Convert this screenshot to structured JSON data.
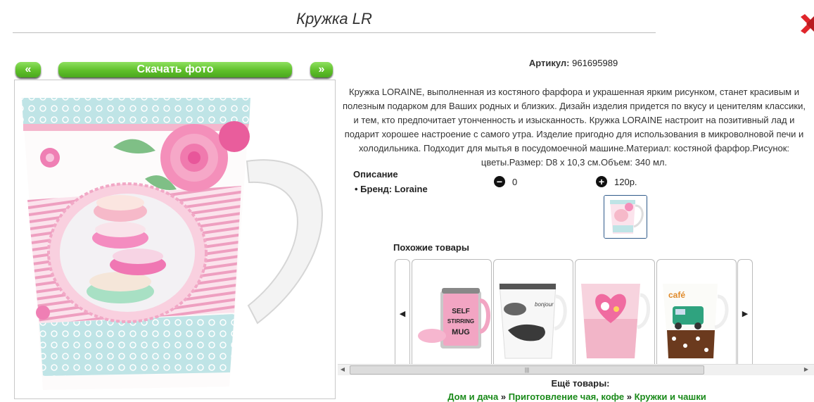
{
  "product": {
    "title": "Кружка LR",
    "sku_label": "Артикул:",
    "sku_value": "961695989",
    "description": "Кружка LORAINE, выполненная из костяного фарфора и украшенная ярким рисунком, станет красивым и полезным подарком для Ваших родных и близких. Дизайн изделия придется по вкусу и ценителям классики, и тем, кто предпочитает утонченность и изысканность. Кружка LORAINE настроит на позитивный лад и подарит хорошее настроение с самого утра. Изделие пригодно для использования в микроволновой печи и холодильника. Подходит для мытья в посудомоечной машине.Материал: костяной фарфор.Рисунок: цветы.Размер: D8 x 10,3 см.Объем: 340 мл.",
    "desc_heading": "Описание",
    "brand": "Бренд: Loraine"
  },
  "gallery": {
    "prev_label": "«",
    "download_label": "Скачать фото",
    "next_label": "»"
  },
  "votes": {
    "down_icon": "minus-circle-icon",
    "down_value": "0",
    "up_icon": "plus-circle-icon",
    "up_value": "120р."
  },
  "similar": {
    "heading": "Похожие товары",
    "prev_icon": "skip-back-icon",
    "next_icon": "skip-forward-icon",
    "cards": [
      {
        "text": "SELF STIRRING MUG"
      },
      {
        "text": "bonjour"
      },
      {
        "text": ""
      },
      {
        "text": "café"
      }
    ]
  },
  "more": {
    "heading": "Ещё товары:",
    "crumbs": [
      "Дом и дача",
      "Приготовление чая, кофе",
      "Кружки и чашки"
    ],
    "separator": "»"
  },
  "colors": {
    "accent_green": "#5fbf2a",
    "link_green": "#1a8a1a",
    "close_red": "#e0252b"
  }
}
